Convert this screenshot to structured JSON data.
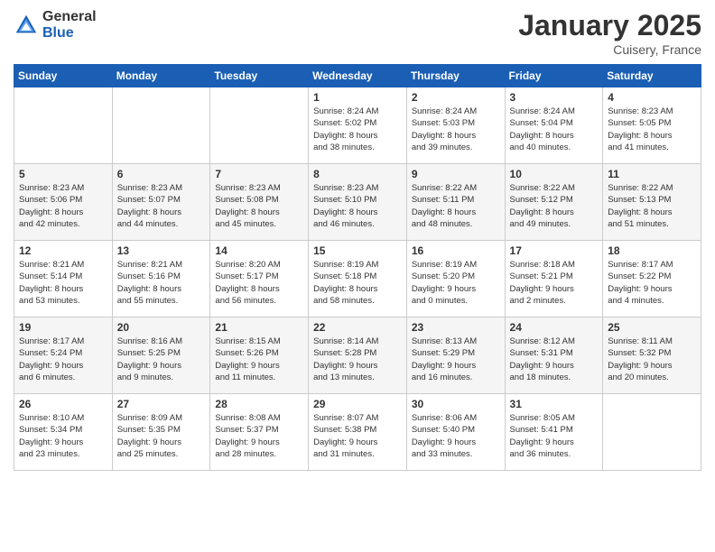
{
  "header": {
    "logo_general": "General",
    "logo_blue": "Blue",
    "month": "January 2025",
    "location": "Cuisery, France"
  },
  "days_of_week": [
    "Sunday",
    "Monday",
    "Tuesday",
    "Wednesday",
    "Thursday",
    "Friday",
    "Saturday"
  ],
  "weeks": [
    [
      {
        "num": "",
        "info": ""
      },
      {
        "num": "",
        "info": ""
      },
      {
        "num": "",
        "info": ""
      },
      {
        "num": "1",
        "info": "Sunrise: 8:24 AM\nSunset: 5:02 PM\nDaylight: 8 hours\nand 38 minutes."
      },
      {
        "num": "2",
        "info": "Sunrise: 8:24 AM\nSunset: 5:03 PM\nDaylight: 8 hours\nand 39 minutes."
      },
      {
        "num": "3",
        "info": "Sunrise: 8:24 AM\nSunset: 5:04 PM\nDaylight: 8 hours\nand 40 minutes."
      },
      {
        "num": "4",
        "info": "Sunrise: 8:23 AM\nSunset: 5:05 PM\nDaylight: 8 hours\nand 41 minutes."
      }
    ],
    [
      {
        "num": "5",
        "info": "Sunrise: 8:23 AM\nSunset: 5:06 PM\nDaylight: 8 hours\nand 42 minutes."
      },
      {
        "num": "6",
        "info": "Sunrise: 8:23 AM\nSunset: 5:07 PM\nDaylight: 8 hours\nand 44 minutes."
      },
      {
        "num": "7",
        "info": "Sunrise: 8:23 AM\nSunset: 5:08 PM\nDaylight: 8 hours\nand 45 minutes."
      },
      {
        "num": "8",
        "info": "Sunrise: 8:23 AM\nSunset: 5:10 PM\nDaylight: 8 hours\nand 46 minutes."
      },
      {
        "num": "9",
        "info": "Sunrise: 8:22 AM\nSunset: 5:11 PM\nDaylight: 8 hours\nand 48 minutes."
      },
      {
        "num": "10",
        "info": "Sunrise: 8:22 AM\nSunset: 5:12 PM\nDaylight: 8 hours\nand 49 minutes."
      },
      {
        "num": "11",
        "info": "Sunrise: 8:22 AM\nSunset: 5:13 PM\nDaylight: 8 hours\nand 51 minutes."
      }
    ],
    [
      {
        "num": "12",
        "info": "Sunrise: 8:21 AM\nSunset: 5:14 PM\nDaylight: 8 hours\nand 53 minutes."
      },
      {
        "num": "13",
        "info": "Sunrise: 8:21 AM\nSunset: 5:16 PM\nDaylight: 8 hours\nand 55 minutes."
      },
      {
        "num": "14",
        "info": "Sunrise: 8:20 AM\nSunset: 5:17 PM\nDaylight: 8 hours\nand 56 minutes."
      },
      {
        "num": "15",
        "info": "Sunrise: 8:19 AM\nSunset: 5:18 PM\nDaylight: 8 hours\nand 58 minutes."
      },
      {
        "num": "16",
        "info": "Sunrise: 8:19 AM\nSunset: 5:20 PM\nDaylight: 9 hours\nand 0 minutes."
      },
      {
        "num": "17",
        "info": "Sunrise: 8:18 AM\nSunset: 5:21 PM\nDaylight: 9 hours\nand 2 minutes."
      },
      {
        "num": "18",
        "info": "Sunrise: 8:17 AM\nSunset: 5:22 PM\nDaylight: 9 hours\nand 4 minutes."
      }
    ],
    [
      {
        "num": "19",
        "info": "Sunrise: 8:17 AM\nSunset: 5:24 PM\nDaylight: 9 hours\nand 6 minutes."
      },
      {
        "num": "20",
        "info": "Sunrise: 8:16 AM\nSunset: 5:25 PM\nDaylight: 9 hours\nand 9 minutes."
      },
      {
        "num": "21",
        "info": "Sunrise: 8:15 AM\nSunset: 5:26 PM\nDaylight: 9 hours\nand 11 minutes."
      },
      {
        "num": "22",
        "info": "Sunrise: 8:14 AM\nSunset: 5:28 PM\nDaylight: 9 hours\nand 13 minutes."
      },
      {
        "num": "23",
        "info": "Sunrise: 8:13 AM\nSunset: 5:29 PM\nDaylight: 9 hours\nand 16 minutes."
      },
      {
        "num": "24",
        "info": "Sunrise: 8:12 AM\nSunset: 5:31 PM\nDaylight: 9 hours\nand 18 minutes."
      },
      {
        "num": "25",
        "info": "Sunrise: 8:11 AM\nSunset: 5:32 PM\nDaylight: 9 hours\nand 20 minutes."
      }
    ],
    [
      {
        "num": "26",
        "info": "Sunrise: 8:10 AM\nSunset: 5:34 PM\nDaylight: 9 hours\nand 23 minutes."
      },
      {
        "num": "27",
        "info": "Sunrise: 8:09 AM\nSunset: 5:35 PM\nDaylight: 9 hours\nand 25 minutes."
      },
      {
        "num": "28",
        "info": "Sunrise: 8:08 AM\nSunset: 5:37 PM\nDaylight: 9 hours\nand 28 minutes."
      },
      {
        "num": "29",
        "info": "Sunrise: 8:07 AM\nSunset: 5:38 PM\nDaylight: 9 hours\nand 31 minutes."
      },
      {
        "num": "30",
        "info": "Sunrise: 8:06 AM\nSunset: 5:40 PM\nDaylight: 9 hours\nand 33 minutes."
      },
      {
        "num": "31",
        "info": "Sunrise: 8:05 AM\nSunset: 5:41 PM\nDaylight: 9 hours\nand 36 minutes."
      },
      {
        "num": "",
        "info": ""
      }
    ]
  ]
}
